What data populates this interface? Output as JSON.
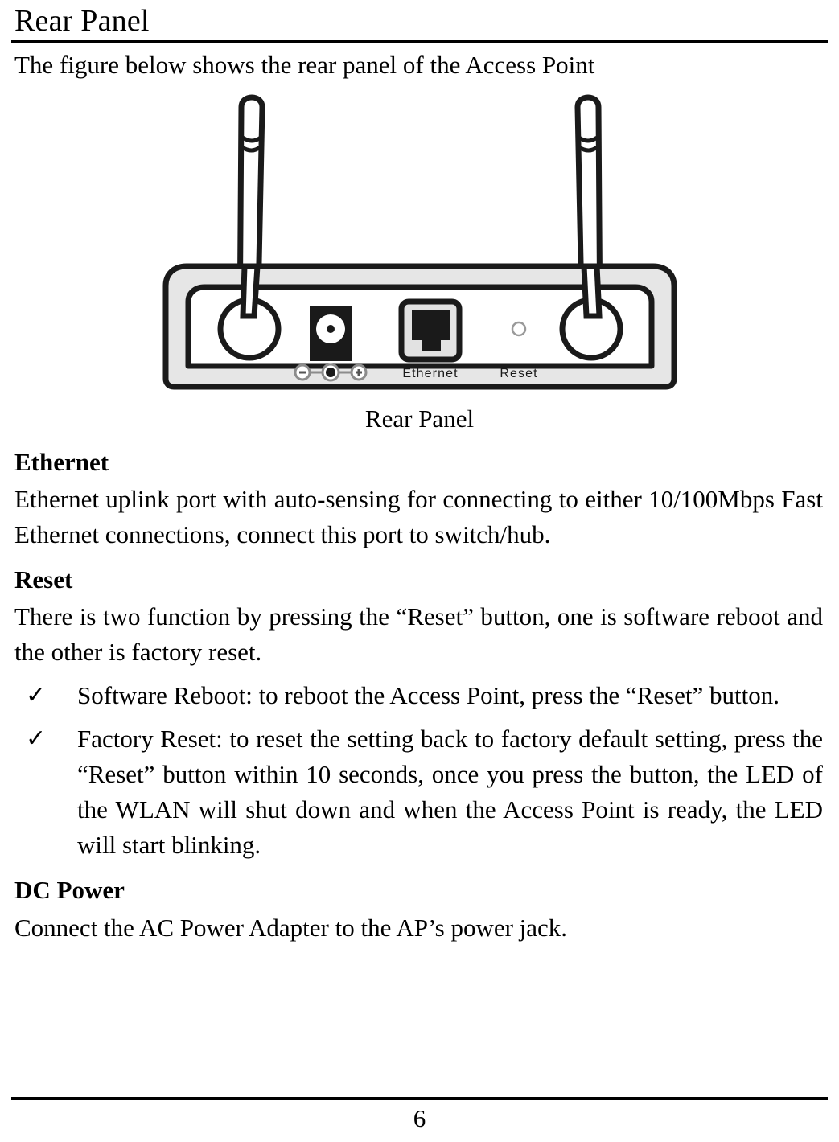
{
  "header": {
    "title": "Rear Panel"
  },
  "intro": {
    "text": "The figure below shows the rear panel of the Access Point"
  },
  "figure": {
    "caption": "Rear Panel",
    "labels": {
      "ethernet_port": "Ethernet",
      "reset_port": "Reset",
      "polarity_minus": "−",
      "polarity_plus": "+"
    },
    "parts": [
      "left-antenna",
      "right-antenna",
      "chassis",
      "dc-power-jack",
      "ethernet-rj45-port",
      "reset-pinhole"
    ],
    "colors": {
      "outline": "#1a1a1a",
      "chassis_fill": "#e6e6e6",
      "panel_fill": "#ffffff",
      "port_dark": "#1a1a1a",
      "pinhole_stroke": "#9a9a9a"
    }
  },
  "sections": [
    {
      "heading": "Ethernet",
      "body": "Ethernet uplink port with auto-sensing for connecting to either 10/100Mbps Fast Ethernet connections, connect this port to switch/hub."
    },
    {
      "heading": "Reset",
      "body": "There is two function by pressing the “Reset” button, one is software reboot and the other is factory reset."
    },
    {
      "heading": "DC Power",
      "body": "Connect the AC Power Adapter to the AP’s power jack."
    }
  ],
  "bullets": [
    {
      "mark": "✓",
      "text": "Software Reboot: to reboot the Access Point, press the “Reset” button."
    },
    {
      "mark": "✓",
      "text": "Factory Reset: to reset the setting back to factory default setting, press the “Reset” button within 10 seconds, once you press the button, the LED of the WLAN will shut down and when the Access Point is ready, the LED will start blinking."
    }
  ],
  "footer": {
    "page_number": "6"
  }
}
